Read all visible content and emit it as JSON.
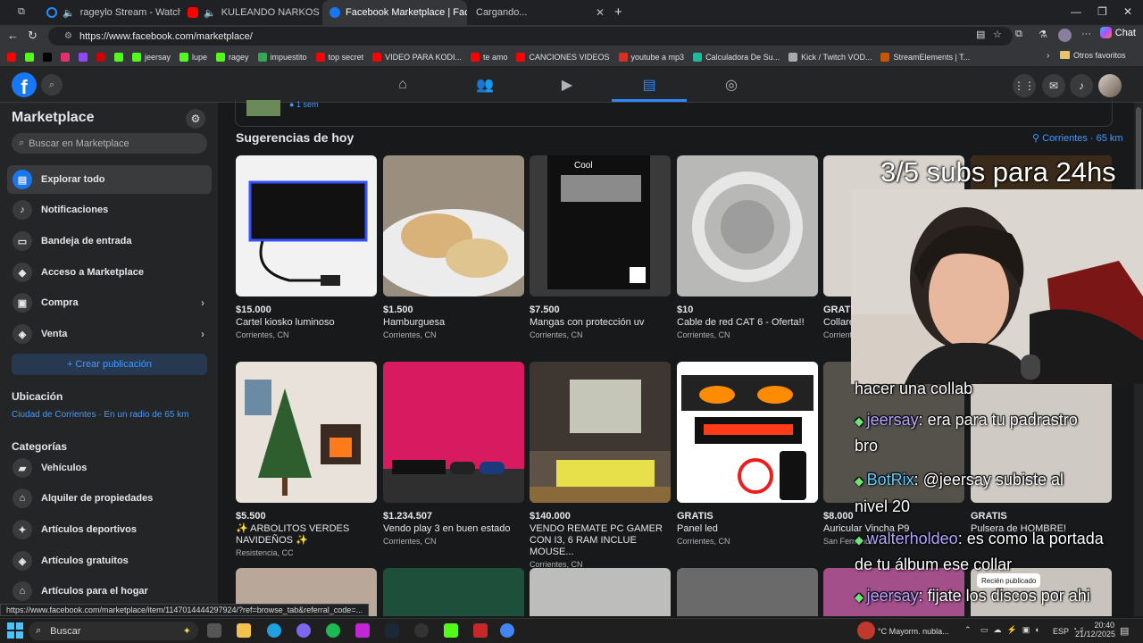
{
  "browser": {
    "tabs": [
      {
        "title": "rageylo Stream - Watch Live o",
        "color": "#1e90ff"
      },
      {
        "title": "KULEANDO NARKOS - banat",
        "color": "#ff0000"
      },
      {
        "title": "Facebook Marketplace | Facebook",
        "color": "#1877f2"
      },
      {
        "title": "Cargando...",
        "color": "#888888"
      }
    ],
    "url": "https://www.facebook.com/marketplace/",
    "chat_label": "Chat",
    "bookmarks": [
      {
        "label": "",
        "color": "#ff0000"
      },
      {
        "label": "",
        "color": "#53fc18"
      },
      {
        "label": "",
        "color": "#000000"
      },
      {
        "label": "",
        "color": "#e1306c"
      },
      {
        "label": "",
        "color": "#9146ff"
      },
      {
        "label": "",
        "color": "#cc0000"
      },
      {
        "label": "",
        "color": "#53fc18"
      },
      {
        "label": "jeersay",
        "color": "#53fc18"
      },
      {
        "label": "lupe",
        "color": "#53fc18"
      },
      {
        "label": "ragey",
        "color": "#53fc18"
      },
      {
        "label": "impuestito",
        "color": "#34a853"
      },
      {
        "label": "top secret",
        "color": "#ff0000"
      },
      {
        "label": "VIDEO PARA KODI...",
        "color": "#ff0000"
      },
      {
        "label": "te amo",
        "color": "#ff0000"
      },
      {
        "label": "CANCIONES VIDEOS",
        "color": "#ff0000"
      },
      {
        "label": "youtube a mp3",
        "color": "#d93025"
      },
      {
        "label": "Calculadora De Su...",
        "color": "#1abc9c"
      },
      {
        "label": "Kick / Twitch VOD...",
        "color": "#aaaaaa"
      },
      {
        "label": "StreamElements | T...",
        "color": "#cc5500"
      }
    ],
    "other_favorites": "Otros favoritos",
    "status_url": "https://www.facebook.com/marketplace/item/1147014444297924/?ref=browse_tab&referral_code=..."
  },
  "sidebar": {
    "title": "Marketplace",
    "search_placeholder": "Buscar en Marketplace",
    "items": [
      {
        "label": "Explorar todo",
        "icon": "storefront-icon",
        "glyph": "▤"
      },
      {
        "label": "Notificaciones",
        "icon": "bell-icon",
        "glyph": "♪"
      },
      {
        "label": "Bandeja de entrada",
        "icon": "inbox-icon",
        "glyph": "▭"
      },
      {
        "label": "Acceso a Marketplace",
        "icon": "shield-icon",
        "glyph": "◆"
      },
      {
        "label": "Compra",
        "icon": "bag-icon",
        "glyph": "▣"
      },
      {
        "label": "Venta",
        "icon": "tag-icon",
        "glyph": "◈"
      }
    ],
    "create_label": "+ Crear publicación",
    "location_heading": "Ubicación",
    "location_text": "Ciudad de Corrientes · En un radio de 65 km",
    "categories_heading": "Categorías",
    "categories": [
      {
        "label": "Vehículos",
        "icon": "car-icon",
        "glyph": "▰"
      },
      {
        "label": "Alquiler de propiedades",
        "icon": "key-icon",
        "glyph": "⌂"
      },
      {
        "label": "Artículos deportivos",
        "icon": "sports-icon",
        "glyph": "✦"
      },
      {
        "label": "Artículos gratuitos",
        "icon": "tag-free-icon",
        "glyph": "◈"
      },
      {
        "label": "Artículos para el hogar",
        "icon": "house-icon",
        "glyph": "⌂"
      }
    ]
  },
  "main": {
    "prev_time": "1 sem",
    "section_title": "Sugerencias de hoy",
    "location_label": "Corrientes · 65 km",
    "listings": [
      {
        "price": "$15.000",
        "title": "Cartel kiosko luminoso",
        "city": "Corrientes, CN",
        "img": "kiosco",
        "bg": "#f2f2f2"
      },
      {
        "price": "$1.500",
        "title": "Hamburguesa",
        "city": "Corrientes, CN",
        "img": "food",
        "bg": "#9a8f7e"
      },
      {
        "price": "$7.500",
        "title": "Mangas con protección uv",
        "city": "Corrientes, CN",
        "img": "pack",
        "bg": "#2a2a2a"
      },
      {
        "price": "$10",
        "title": "Cable de red CAT 6 - Oferta!!",
        "city": "Corrientes, CN",
        "img": "cable",
        "bg": "#b8b8b6"
      },
      {
        "price": "GRATIS",
        "title": "Collares",
        "city": "Corrientes, CN",
        "img": "plain",
        "bg": "#d8d3cc"
      },
      {
        "price": "",
        "title": "",
        "city": "",
        "img": "burger",
        "bg": "#c9a26a"
      },
      {
        "price": "$5.500",
        "title": "✨ ARBOLITOS VERDES NAVIDEÑOS ✨",
        "city": "Resistencia, CC",
        "img": "tree",
        "bg": "#e8e2da"
      },
      {
        "price": "$1.234.507",
        "title": "Vendo play 3 en buen estado",
        "city": "Corrientes, CN",
        "img": "tv",
        "bg": "#c2185b"
      },
      {
        "price": "$140.000",
        "title": "VENDO REMATE PC GAMER CON I3, 6 RAM INCLUE MOUSE...",
        "city": "Corrientes, CN",
        "img": "pc",
        "bg": "#5e5246"
      },
      {
        "price": "GRATIS",
        "title": "Panel led",
        "city": "Corrientes, CN",
        "img": "led",
        "bg": "#ffffff"
      },
      {
        "price": "$8.000",
        "title": "Auricular Vincha P9",
        "city": "San Fernando",
        "img": "plain",
        "bg": "#55524c"
      },
      {
        "price": "GRATIS",
        "title": "Pulsera de HOMBRE!",
        "city": "",
        "img": "plain",
        "bg": "#cfcac3"
      }
    ]
  },
  "overlay": {
    "banner": "3/5 subs para 24hs",
    "chat": [
      {
        "user": "",
        "text": "hacer una collab"
      },
      {
        "user": "jeersay",
        "text": ": era para tu padrastro"
      },
      {
        "user": "",
        "text": "bro"
      },
      {
        "user": "BotRix",
        "text": ": @jeersay subiste al"
      },
      {
        "user": "",
        "text": "nivel 20"
      },
      {
        "user": "walterholdeo",
        "text": ": es como la portada"
      },
      {
        "user": "",
        "text": "de tu álbum ese collar"
      },
      {
        "user": "jeersay",
        "text": ": fijate los discos por ahi"
      }
    ],
    "recent_badge": "Recién publicado"
  },
  "taskbar": {
    "search_label": "Buscar",
    "weather": "°C  Mayorm. nubla...",
    "lang": "ESP",
    "time": "20:40",
    "date": "21/12/2025"
  }
}
